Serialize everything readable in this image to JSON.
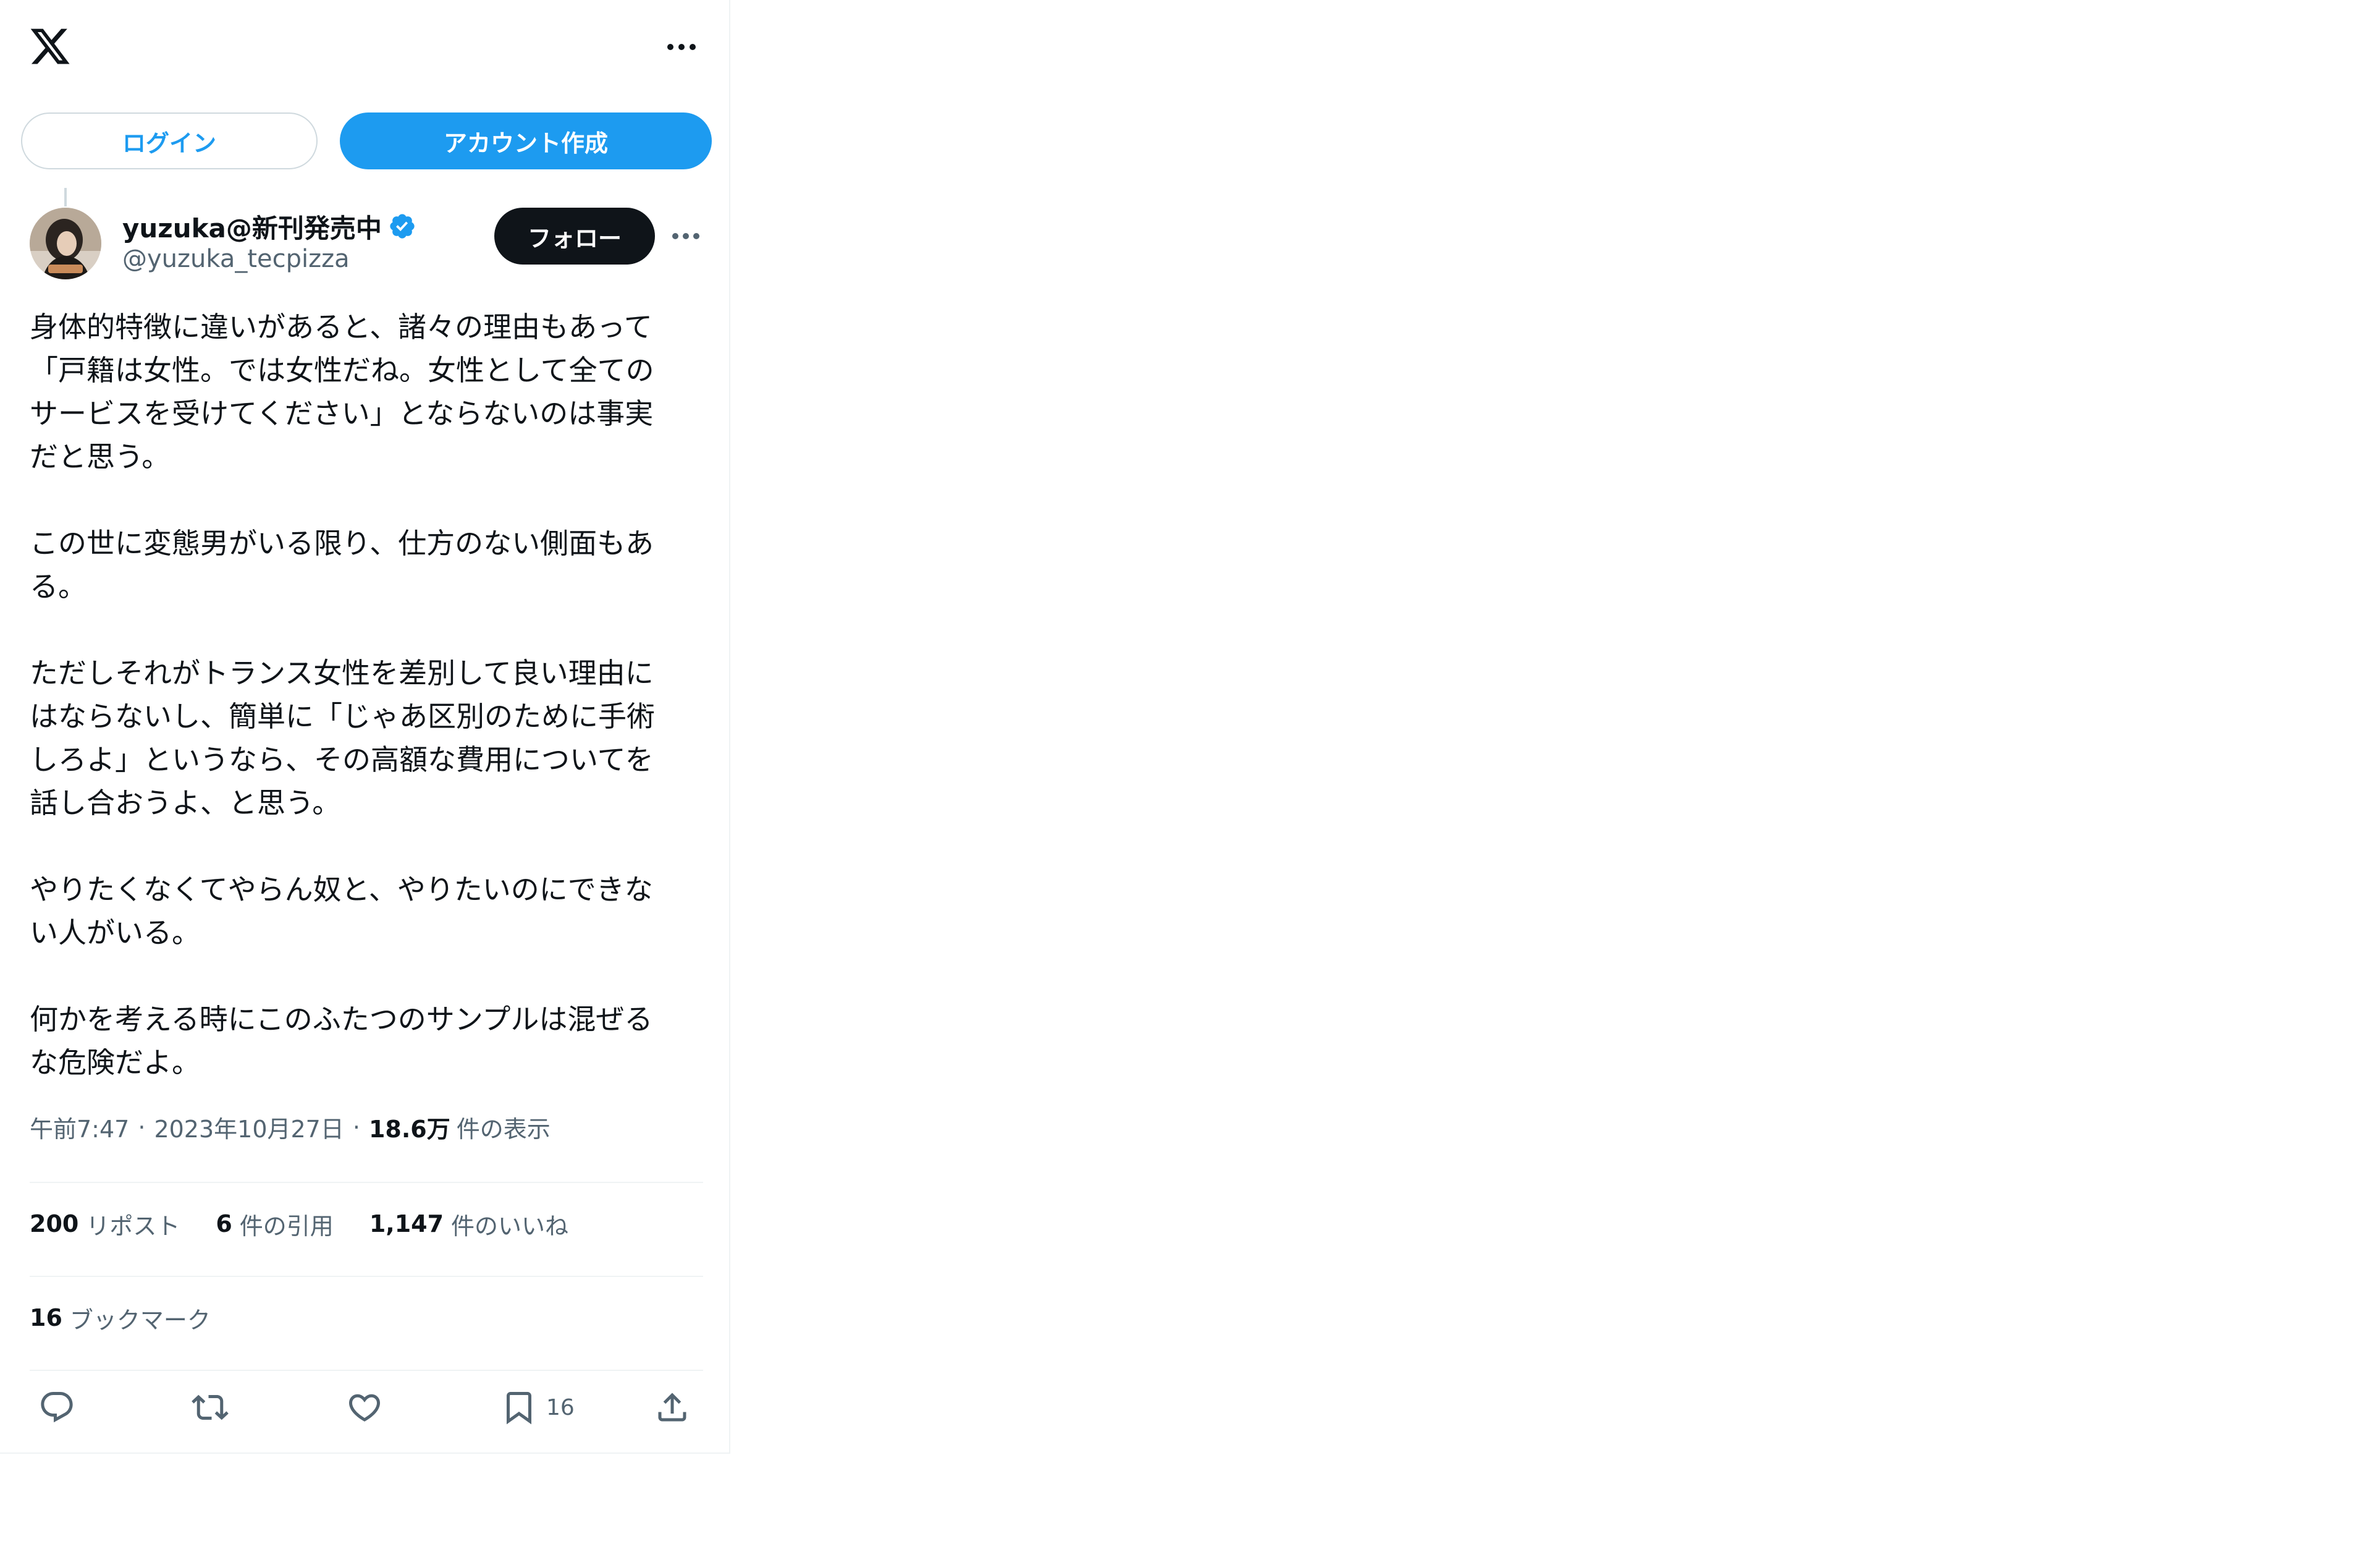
{
  "header": {
    "logo_icon": "x-logo-icon",
    "more_icon": "more-horizontal-icon"
  },
  "auth": {
    "login_label": "ログイン",
    "signup_label": "アカウント作成"
  },
  "author": {
    "display_name": "yuzuka@新刊発売中",
    "handle": "@yuzuka_tecpizza",
    "verified": true,
    "follow_label": "フォロー"
  },
  "tweet": {
    "text": "身体的特徴に違いがあると、諸々の理由もあって\n「戸籍は女性。では女性だね。女性として全ての\nサービスを受けてください」とならないのは事実\nだと思う。\n\nこの世に変態男がいる限り、仕方のない側面もあ\nる。\n\nただしそれがトランス女性を差別して良い理由に\nはならないし、簡単に「じゃあ区別のために手術\nしろよ」というなら、その高額な費用についてを\n話し合おうよ、と思う。\n\nやりたくなくてやらん奴と、やりたいのにできな\nい人がいる。\n\n何かを考える時にこのふたつのサンプルは混ぜる\nな危険だよ。",
    "time": "午前7:47",
    "date": "2023年10月27日",
    "views_count": "18.6万",
    "views_label": "件の表示",
    "dot": "·"
  },
  "stats": {
    "reposts_count": "200",
    "reposts_label": "リポスト",
    "quotes_count": "6",
    "quotes_label": "件の引用",
    "likes_count": "1,147",
    "likes_label": "件のいいね",
    "bookmarks_count": "16",
    "bookmarks_label": "ブックマーク"
  },
  "actions": {
    "reply_icon": "reply-icon",
    "repost_icon": "repost-icon",
    "like_icon": "like-icon",
    "bookmark_icon": "bookmark-icon",
    "bookmark_count": "16",
    "share_icon": "share-icon"
  },
  "colors": {
    "accent": "#1d9bf0",
    "text": "#0f1419",
    "secondary": "#536471",
    "border": "#eff3f4"
  }
}
